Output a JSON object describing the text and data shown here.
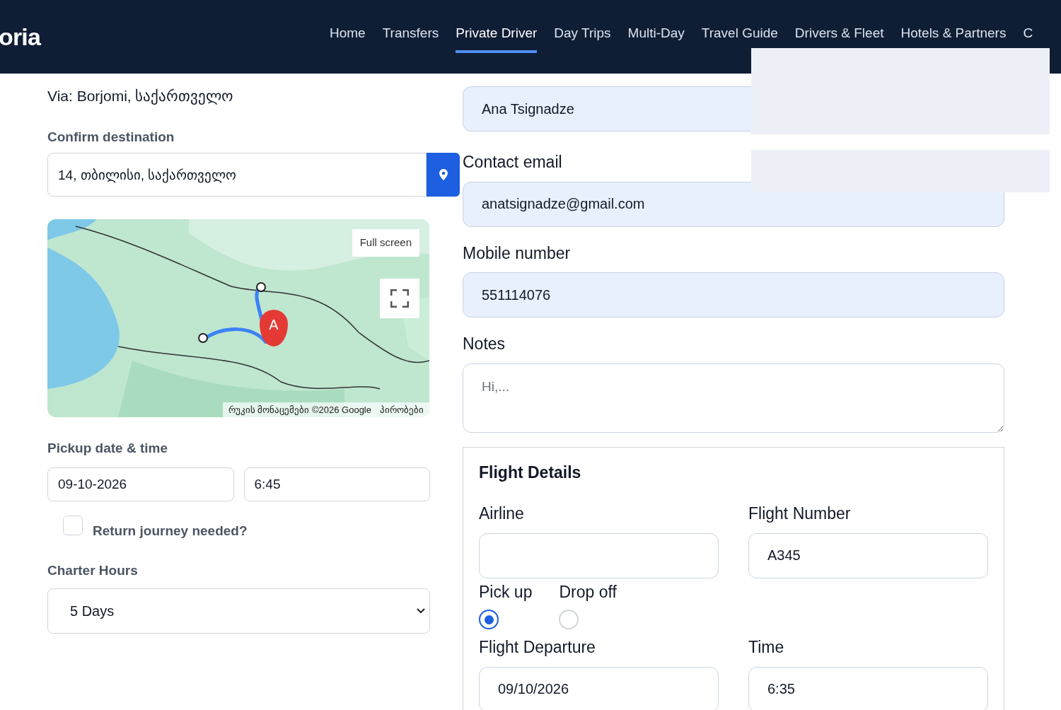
{
  "header": {
    "logo": "oria",
    "nav": [
      {
        "label": "Home",
        "selected": false
      },
      {
        "label": "Transfers",
        "selected": false
      },
      {
        "label": "Private Driver",
        "selected": true
      },
      {
        "label": "Day Trips",
        "selected": false
      },
      {
        "label": "Multi-Day",
        "selected": false
      },
      {
        "label": "Travel Guide",
        "selected": false
      },
      {
        "label": "Drivers & Fleet",
        "selected": false
      },
      {
        "label": "Hotels & Partners",
        "selected": false
      },
      {
        "label": "C",
        "selected": false
      }
    ]
  },
  "route": {
    "via": "Via: Borjomi, საქართველო",
    "destination_label": "Confirm destination",
    "destination": "14, თბილისი, საქართველო"
  },
  "map": {
    "kind": "picture",
    "fullscreen_button": "Full screen",
    "marker": "A",
    "attribution": "რუკის მონაცემები ©2026 Google",
    "terms": "პირობები"
  },
  "pickup": {
    "label": "Pickup date & time",
    "date": "09-10-2026",
    "time": "6:45"
  },
  "return_journey": {
    "label": "Return journey needed?",
    "checked": false
  },
  "charter": {
    "label": "Charter Hours",
    "value": "5 Days"
  },
  "contact": {
    "name": "Ana Tsignadze",
    "email_label": "Contact email",
    "email": "anatsignadze@gmail.com",
    "mobile_label": "Mobile number",
    "mobile": "551114076",
    "notes_label": "Notes",
    "notes_placeholder": "Hi,..."
  },
  "flight": {
    "title": "Flight Details",
    "airline_label": "Airline",
    "number_label": "Flight Number",
    "number": "A345",
    "direction": [
      {
        "label": "Pick up",
        "selected": true
      },
      {
        "label": "Drop off",
        "selected": false
      }
    ],
    "departure_label": "Flight Departure",
    "departure": "09/10/2026",
    "time_label": "Time",
    "time": "6:35"
  }
}
